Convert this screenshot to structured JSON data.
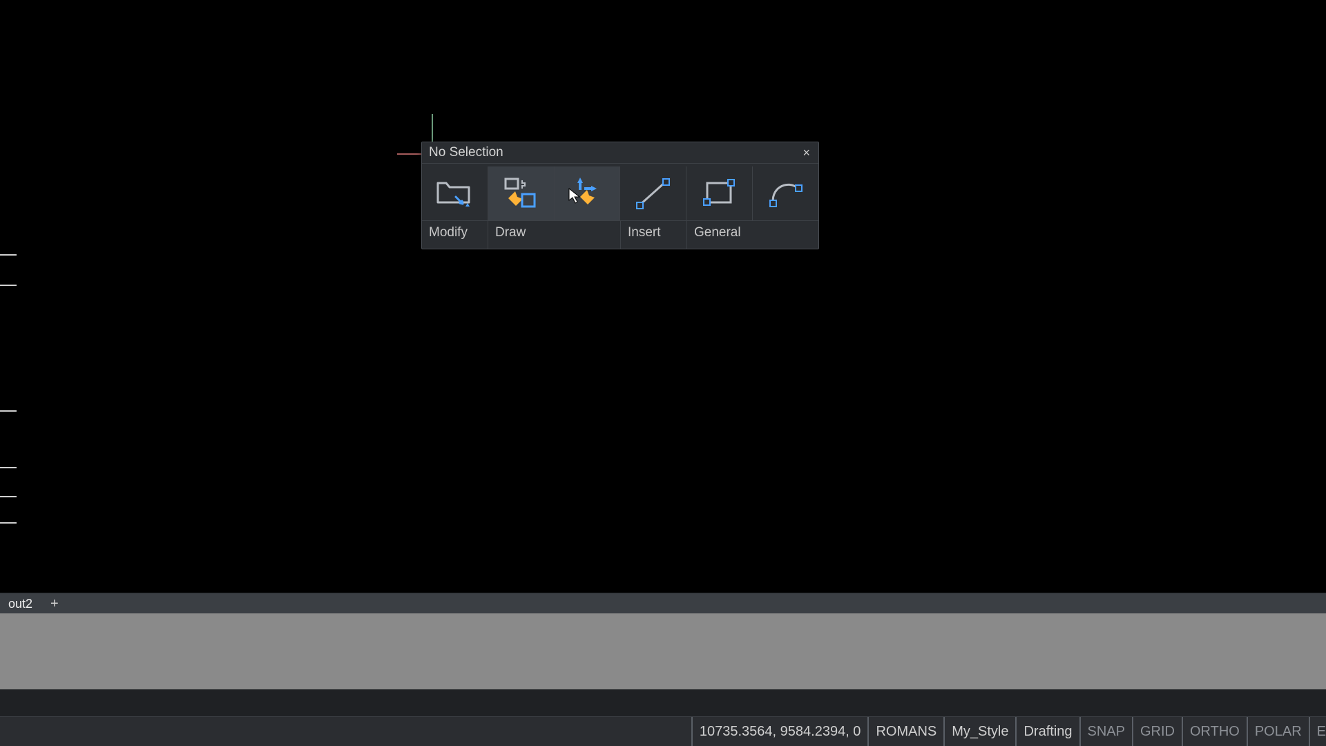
{
  "panel": {
    "title": "No Selection",
    "close_glyph": "×",
    "groups": {
      "modify": "Modify",
      "draw": "Draw",
      "insert": "Insert",
      "general": "General"
    }
  },
  "tabs": {
    "layout2": "out2",
    "add_glyph": "+"
  },
  "status": {
    "coords": "10735.3564, 9584.2394, 0",
    "textstyle": "ROMANS",
    "dimstyle": "My_Style",
    "annoscale": "Drafting",
    "snap": "SNAP",
    "grid": "GRID",
    "ortho": "ORTHO",
    "polar": "POLAR",
    "extras_cut": "E"
  },
  "colors": {
    "icon_blue": "#4aa0ff",
    "icon_orange": "#ffb338",
    "icon_grey": "#b8bdc4",
    "panel_bg": "#2a2d31"
  }
}
